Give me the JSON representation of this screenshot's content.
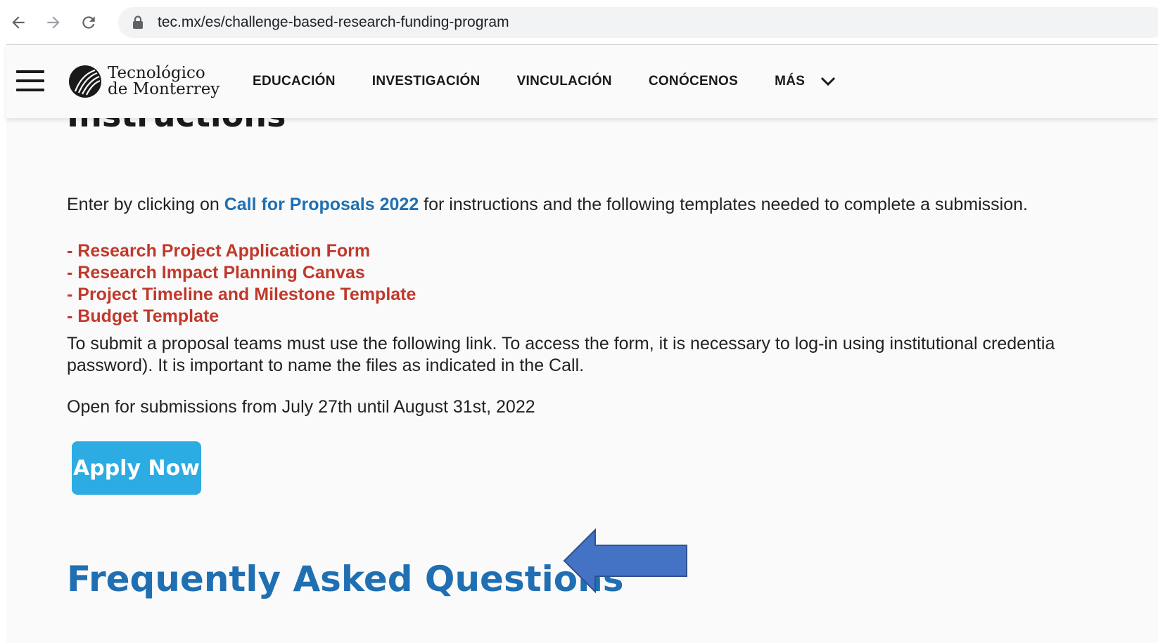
{
  "browser": {
    "url": "tec.mx/es/challenge-based-research-funding-program"
  },
  "header": {
    "logo_line1": "Tecnológico",
    "logo_line2": "de Monterrey",
    "nav": [
      {
        "label": "EDUCACIÓN"
      },
      {
        "label": "INVESTIGACIÓN"
      },
      {
        "label": "VINCULACIÓN"
      },
      {
        "label": "CONÓCENOS"
      },
      {
        "label": "MÁS"
      }
    ]
  },
  "main": {
    "section_title": "Instructions",
    "intro_before": "Enter by clicking on ",
    "intro_link": "Call for Proposals 2022",
    "intro_after": " for instructions and the following templates needed to complete a submission.",
    "templates": [
      "- Research Project Application Form",
      "- Research Impact Planning Canvas",
      "- Project Timeline and Milestone Template",
      "- Budget Template"
    ],
    "submit_line1": "To submit a proposal teams must use the following link. To access the form, it is necessary to log-in using institutional credentia",
    "submit_line2": "password). It is important to name the files as indicated in the Call.",
    "open_dates": "Open for submissions from July 27th until August 31st, 2022",
    "apply_label": "Apply Now",
    "faq_title": "Frequently Asked Questions"
  },
  "colors": {
    "link_blue": "#1f6fb2",
    "template_red": "#c0392b",
    "apply_button": "#2cace2",
    "arrow_fill": "#4472c4"
  },
  "icons": {
    "back": "arrow-left-icon",
    "forward": "arrow-right-icon",
    "reload": "reload-icon",
    "lock": "lock-icon",
    "menu": "hamburger-icon",
    "dropdown": "chevron-down-icon",
    "annotation": "arrow-left-annotation"
  }
}
